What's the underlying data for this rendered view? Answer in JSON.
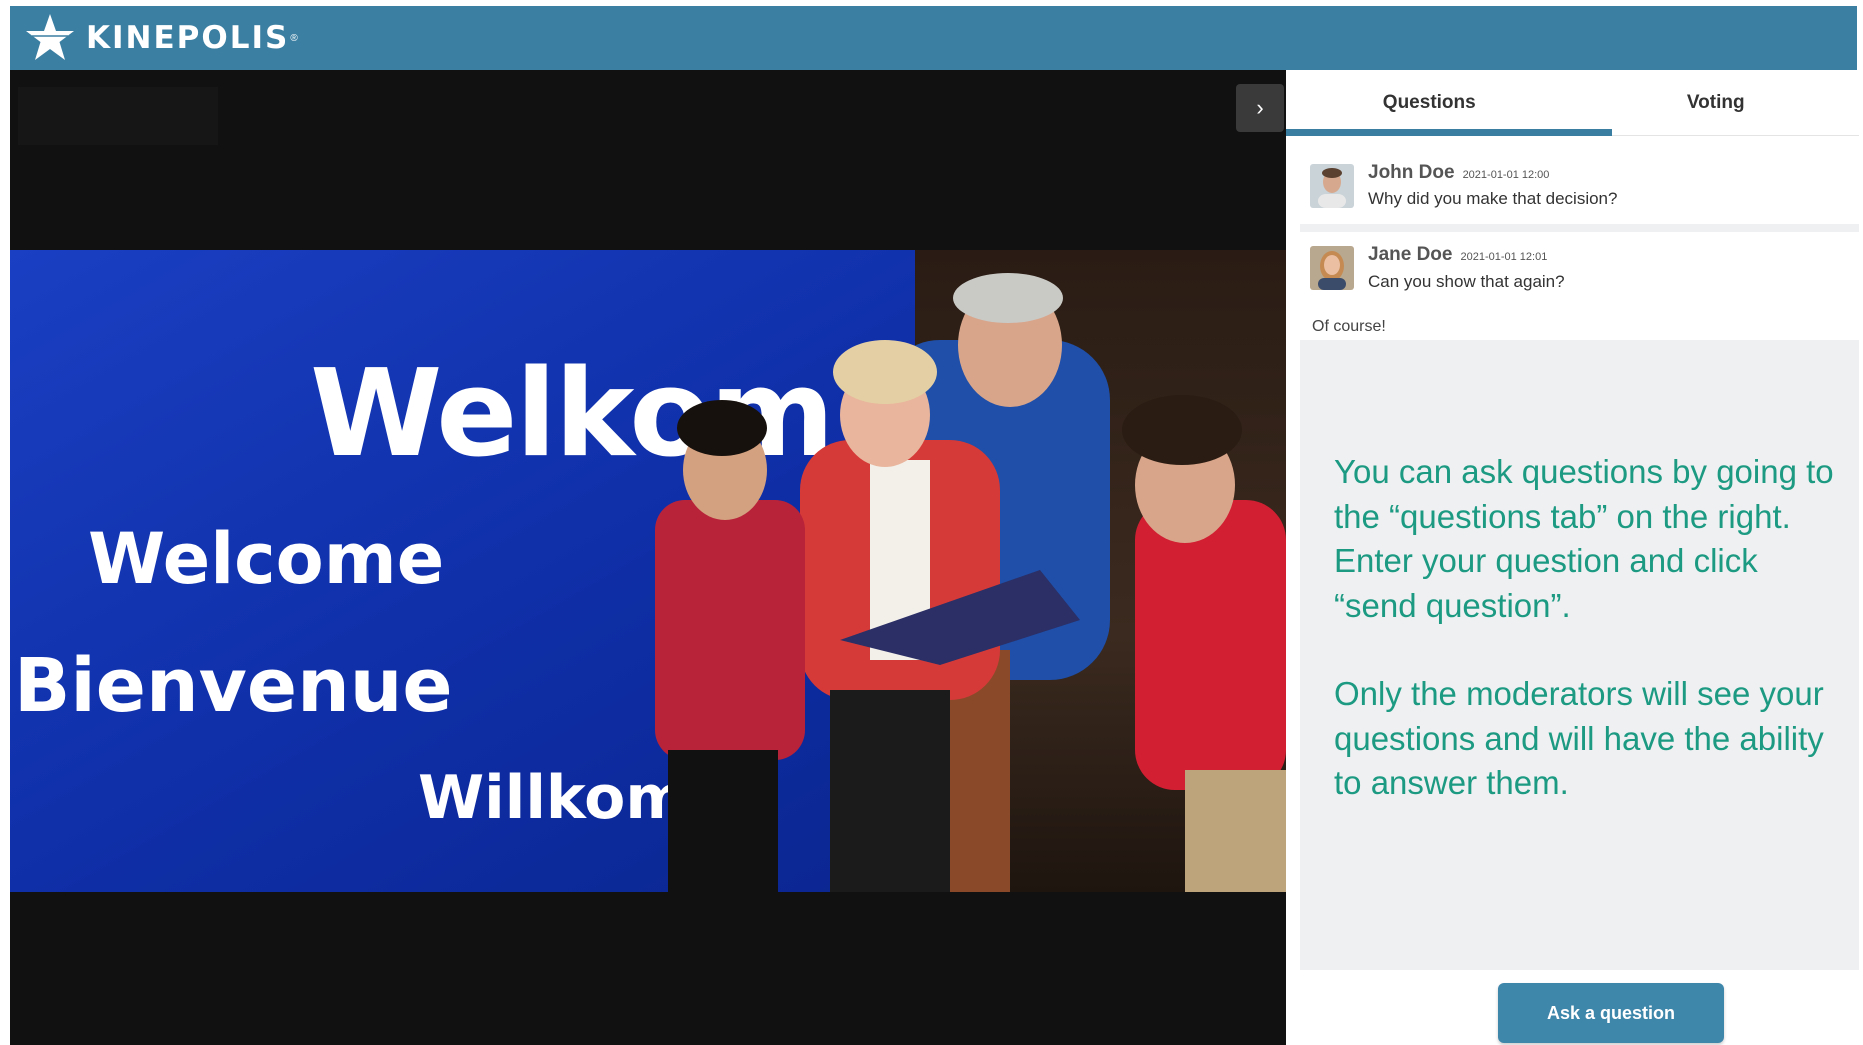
{
  "header": {
    "brand": "KINEPOLIS",
    "brand_mark": "®",
    "logo_icon": "star-icon",
    "color": "#3b7fa2"
  },
  "player": {
    "collapse_icon": "chevron-right-icon",
    "collapse_label": "›",
    "signage": {
      "dutch": "Welkom",
      "english": "Welcome",
      "french": "Bienvenue",
      "german": "Willkomm"
    }
  },
  "panel": {
    "tabs": [
      {
        "label": "Questions",
        "active": true
      },
      {
        "label": "Voting",
        "active": false
      }
    ],
    "questions": [
      {
        "author": "John Doe",
        "time": "2021-01-01 12:00",
        "text": "Why did you make that decision?",
        "avatar_icon": "user-avatar-icon"
      },
      {
        "author": "Jane Doe",
        "time": "2021-01-01 12:01",
        "text": "Can you show that again?",
        "avatar_icon": "user-avatar-icon",
        "answer": "Of course!"
      }
    ],
    "help_text": [
      "You can ask questions by going to the “questions tab” on the right. Enter your question and click “send question”.",
      "Only the moderators will see your questions and will have the ability to answer them."
    ],
    "ask_button": "Ask a question",
    "accent_color": "#3a7ea2",
    "help_color": "#1c9a82"
  }
}
